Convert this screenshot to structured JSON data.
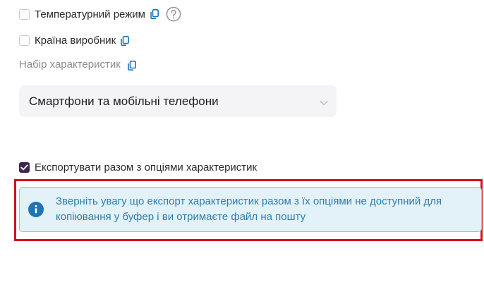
{
  "filters": {
    "temperature_mode": {
      "label": "Температурний режим",
      "checked": false
    },
    "country_of_origin": {
      "label": "Країна виробник",
      "checked": false
    }
  },
  "characteristics_set": {
    "title": "Набір характеристик",
    "selected_value": "Смартфони та мобільні телефони"
  },
  "export_with_options": {
    "label": "Експортувати разом з опціями характеристик",
    "checked": true
  },
  "notice": {
    "message": "Зверніть увагу що експорт характеристик разом з їх опціями не доступний для копіювання у буфер і ви отримаєте файл на пошту"
  },
  "colors": {
    "accent_checkbox": "#3b2452",
    "icon_blue": "#1f74b8",
    "notice_bg": "#e3f1f8",
    "notice_text": "#2b7fb0",
    "highlight_border": "#d6121c"
  },
  "icons": {
    "copy": "copy-icon",
    "help": "help-icon",
    "chevron": "chevron-down-icon",
    "info": "info-icon",
    "check": "check-icon"
  }
}
